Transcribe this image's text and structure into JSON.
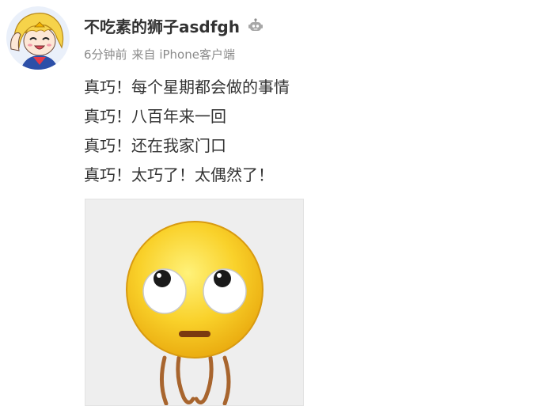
{
  "post": {
    "author": "不吃素的狮子asdfgh",
    "badge_icon": "robot-badge-icon",
    "time": "6分钟前",
    "source": "来自 iPhone客户端",
    "lines": [
      "真巧！每个星期都会做的事情",
      "真巧！八百年来一回",
      "真巧！还在我家门口",
      "真巧！太巧了！太偶然了！"
    ],
    "image_icon": "rolling-eyes-emoji-icon"
  },
  "colors": {
    "text": "#333333",
    "meta": "#8a8a8a",
    "image_bg": "#eeeeee",
    "emoji_yellow": "#f7c21d"
  }
}
